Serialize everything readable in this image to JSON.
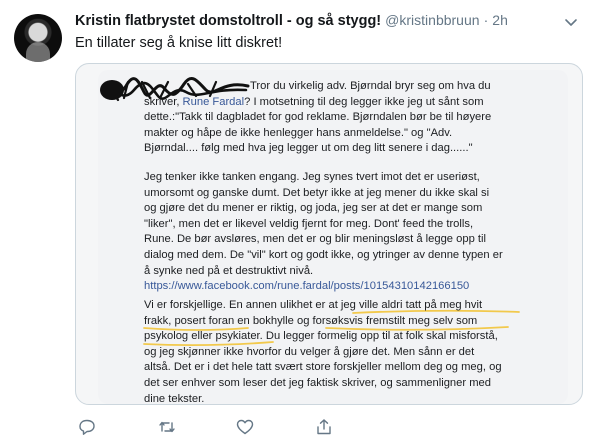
{
  "tweet": {
    "display_name": "Kristin flatbrystet domstoltroll - og så stygg!",
    "handle": "@kristinbbruun",
    "separator": "·",
    "time": "2h",
    "text": "En tillater seg å knise litt diskret!",
    "icons": {
      "more": "chevron-down-icon",
      "reply": "reply-icon",
      "retweet": "retweet-icon",
      "like": "heart-icon",
      "share": "share-icon"
    },
    "colors": {
      "link": "#385898",
      "muted": "#657786",
      "highlight": "#f2c94c"
    }
  },
  "screenshot": {
    "p1": {
      "l0": "Tror du virkelig adv. Bjørndal bryr seg om hva du",
      "l1a": "skriver, ",
      "l1b": "Rune Fardal",
      "l1c": "? I motsetning til deg legger ikke jeg ut sånt som",
      "l2": "dette.:\"Takk til dagbladet for god reklame. Bjørndalen bør be til høyere",
      "l3": "makter og håpe de ikke henlegger hans anmeldelse.\" og \"Adv.",
      "l4": "Bjørndal.... følg med hva jeg legger ut om deg litt senere i dag......\""
    },
    "p2": {
      "l0": "Jeg tenker ikke tanken engang. Jeg synes tvert imot det er useriøst,",
      "l1": "umorsomt og ganske dumt. Det betyr ikke at jeg mener du ikke skal si",
      "l2": "og gjøre det du mener er riktig, og joda, jeg ser at det er mange som",
      "l3": "\"liker\", men det er likevel veldig fjernt for meg. Dont' feed the trolls,",
      "l4": "Rune. De bør avsløres, men det er og blir meningsløst å legge opp til",
      "l5": "dialog med dem. De \"vil\" kort og godt ikke, og ytringer av denne typen er",
      "l6": "å synke ned på et destruktivt nivå.",
      "link": "https://www.facebook.com/rune.fardal/posts/10154310142166150"
    },
    "p3": {
      "l0": "Vi er forskjellige. En annen ulikhet er at jeg ville aldri tatt på meg hvit",
      "l1": "frakk, posert foran en bokhylle og forsøksvis fremstilt meg selv som",
      "l2": "psykolog eller psykiater. Du legger formelig opp til at folk skal misforstå,",
      "l3": "og jeg skjønner ikke hvorfor du velger å gjøre det. Men sånn er det",
      "l4": "altså. Det er i det hele tatt svært store forskjeller mellom deg og meg, og",
      "l5": "det ser enhver som leser det jeg faktisk skriver, og sammenligner med",
      "l6": "dine tekster."
    }
  }
}
